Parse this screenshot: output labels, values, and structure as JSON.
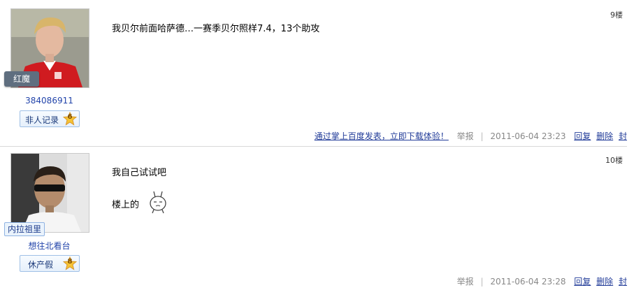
{
  "posts": [
    {
      "badge": "红魔",
      "username": "384086911",
      "level_title": "非人记录",
      "level_num": "6",
      "floor": "9楼",
      "content_lines": [
        "我贝尔前面哈萨德…一赛季贝尔照样7.4，13个助攻"
      ],
      "promo_link": "通过掌上百度发表，立即下载体验！",
      "report": "举报",
      "timestamp": "2011-06-04 23:23",
      "actions": [
        "回复",
        "删除",
        "封"
      ]
    },
    {
      "badge": "内拉祖里",
      "username": "想往北看台",
      "level_title": "休产假",
      "level_num": "8",
      "floor": "10楼",
      "content_lines": [
        "我自己试试吧",
        "楼上的"
      ],
      "report": "举报",
      "timestamp": "2011-06-04 23:28",
      "actions": [
        "回复",
        "删除",
        "封"
      ]
    }
  ],
  "colors": {
    "link": "#223c99",
    "badge_dark": "#5f6e7f",
    "divider": "#d8d8d8"
  }
}
